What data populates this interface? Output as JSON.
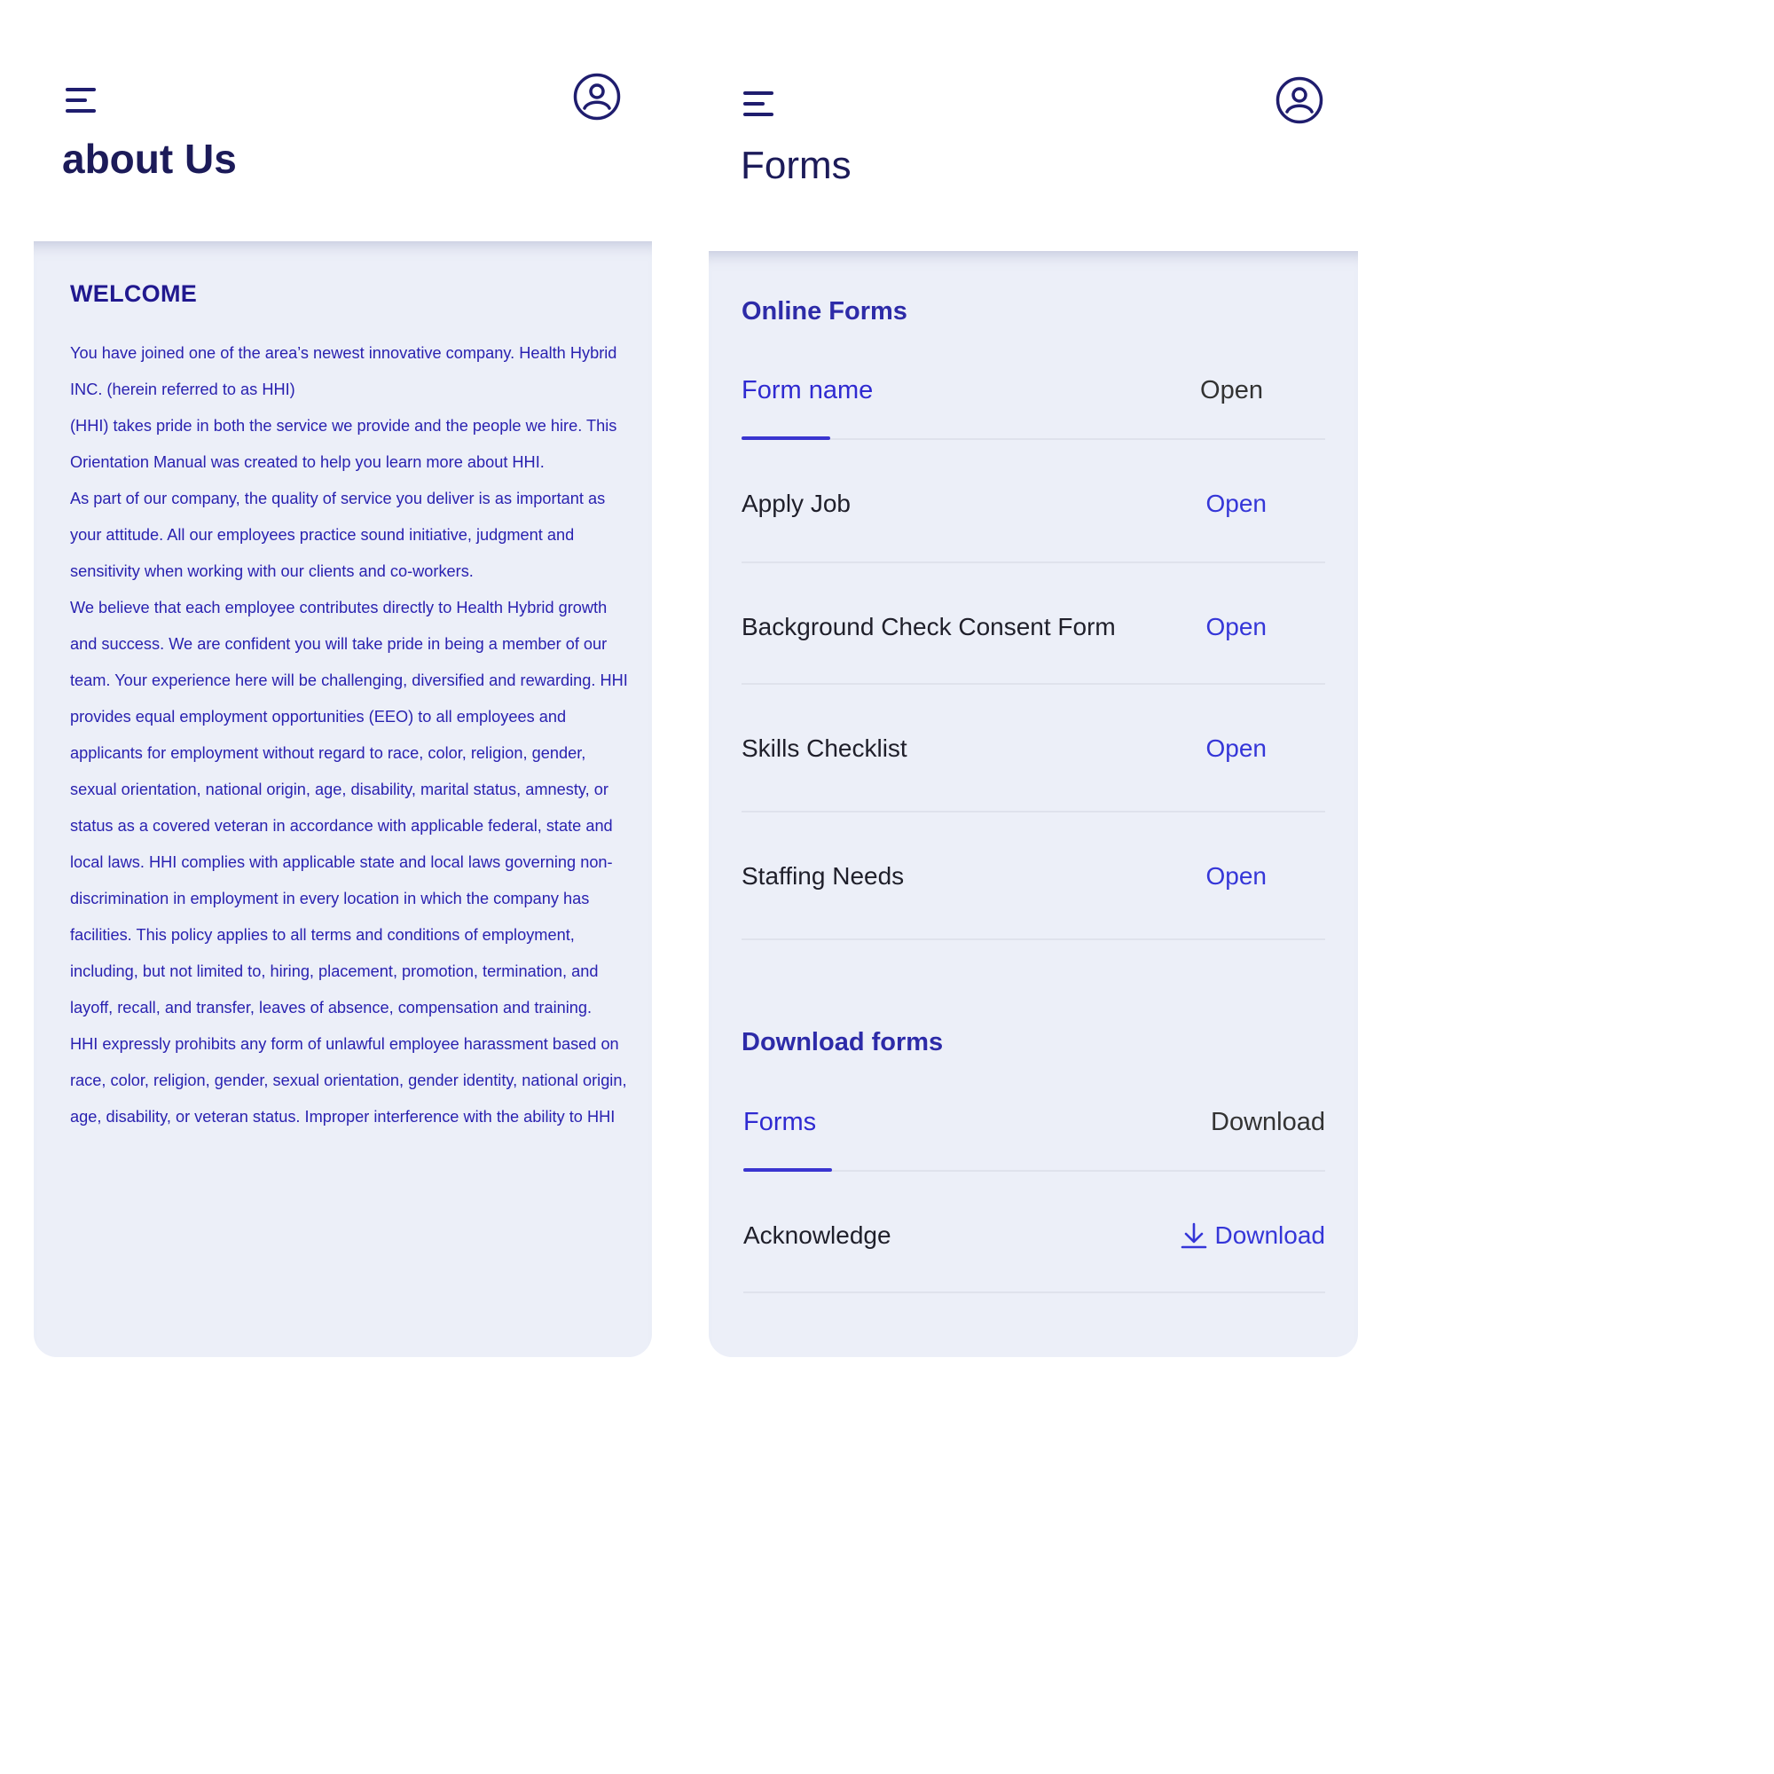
{
  "about_screen": {
    "title": "about Us",
    "menu_icon": "hamburger-menu-icon",
    "profile_icon": "user-circle-icon",
    "welcome_heading": "WELCOME",
    "paragraphs": [
      "You have joined one of the area’s newest innovative company. Health Hybrid INC. (herein referred to as HHI)",
      "(HHI) takes pride in both the service we provide and the people we hire. This Orientation Manual was created to help you learn more about HHI.",
      "As part of our company, the quality of service you deliver is as important as your attitude. All our employees practice sound initiative, judgment and sensitivity when working with our clients and co-workers.",
      "We believe that each employee contributes directly to Health Hybrid growth and success. We are confident you will take pride in being a member of our team. Your experience here will be challenging, diversified and rewarding. HHI provides equal employment opportunities (EEO) to all employees and applicants for employment without regard to race, color, religion, gender, sexual orientation, national origin, age, disability, marital status, amnesty, or status as a covered veteran in accordance with applicable federal, state and local laws. HHI complies with applicable state and local laws governing non- discrimination in employment in every location in which the company has facilities. This policy applies to all terms and conditions of employment, including, but not limited to, hiring, placement, promotion, termination, and layoff, recall, and transfer, leaves of absence, compensation and training.",
      "HHI expressly prohibits any form of unlawful employee harassment based on race, color, religion, gender, sexual orientation, gender identity, national origin, age, disability, or veteran status. Improper interference with the ability to HHI"
    ]
  },
  "forms_screen": {
    "title": "Forms",
    "menu_icon": "hamburger-menu-icon",
    "profile_icon": "user-circle-icon",
    "online_forms": {
      "title": "Online Forms",
      "header": {
        "name": "Form name",
        "action": "Open"
      },
      "rows": [
        {
          "name": "Apply Job",
          "action": "Open"
        },
        {
          "name": "Background Check Consent Form",
          "action": "Open"
        },
        {
          "name": "Skills Checklist",
          "action": "Open"
        },
        {
          "name": "Staffing Needs",
          "action": "Open"
        }
      ]
    },
    "download_forms": {
      "title": "Download forms",
      "header": {
        "name": "Forms",
        "action": "Download"
      },
      "rows": [
        {
          "name": "Acknowledge",
          "action": "Download",
          "icon": "download-icon"
        }
      ]
    }
  }
}
